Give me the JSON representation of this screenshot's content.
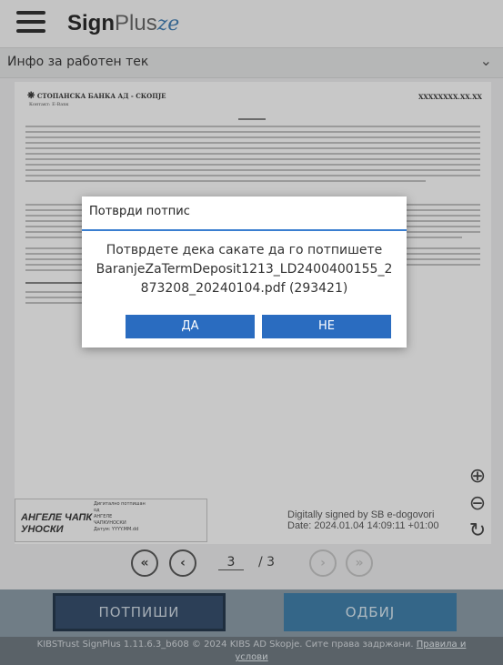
{
  "header": {
    "logo_bold": "Sign",
    "logo_light": "Plus",
    "logo_swash": "ze"
  },
  "infobar": {
    "label": "Инфо за работен тек",
    "chevron_icon": "chevron-down-icon"
  },
  "document": {
    "bank_name": "СТОПАНСКА БАНКА АД - СКОПЈЕ",
    "bank_city": "Контакт: E-Вanк",
    "doc_number": "XXXXXXXX.XX.XX",
    "signature_left": {
      "name_line1": "АНГЕЛЕ ЧАПК",
      "name_line2": "УНОСКИ",
      "small_line1": "Дигитално потпишан",
      "small_line2": "од",
      "small_line3": "АНГЕЛЕ",
      "small_line4": "ЧАПКУНОСКИ",
      "small_line5": "Датум: YYYY.MM.dd"
    },
    "signature_right": {
      "line1": "Digitally signed by SB e-dogovori",
      "line2": "Date: 2024.01.04 14:09:11 +01:00"
    }
  },
  "zoom": {
    "zoom_in_icon": "⊕",
    "zoom_out_icon": "⊖",
    "reset_icon": "↻"
  },
  "pager": {
    "first_label": "«",
    "prev_label": "‹",
    "current_page": "3",
    "separator": "/ 3",
    "next_label": "›",
    "last_label": "»"
  },
  "actions": {
    "sign_label": "ПОТПИШИ",
    "reject_label": "ОДБИЈ"
  },
  "footer": {
    "text": "KIBSTrust SignPlus 1.11.6.3_b608 © 2024 KIBS AD Skopje. Сите права задржани.",
    "link_line1": "Правила и",
    "link_line2": "услови"
  },
  "modal": {
    "title": "Потврди потпис",
    "message_line1": "Потврдете дека сакате да го потпишете",
    "message_line2": "BaranjeZaTermDeposit1213_LD2400400155_2",
    "message_line3": "873208_20240104.pdf (293421)",
    "yes_label": "ДА",
    "no_label": "НЕ"
  },
  "colors": {
    "accent": "#2a6cc0",
    "sign_button": "#1f3a5a",
    "reject_button": "#2a6f9e",
    "footer": "#5f6a72"
  }
}
